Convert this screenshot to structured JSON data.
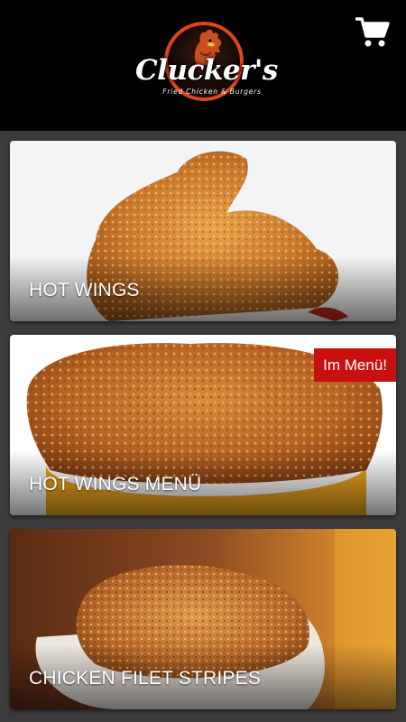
{
  "header": {
    "logo_name": "Clucker's",
    "logo_tagline": "Fried Chicken & Burgers",
    "cart_icon": "shopping-cart-icon"
  },
  "categories": [
    {
      "title": "HOT WINGS",
      "badge": ""
    },
    {
      "title": "HOT WINGS MENÜ",
      "badge": "Im Menü!"
    },
    {
      "title": "CHICKEN FILET STRIPES",
      "badge": ""
    }
  ],
  "colors": {
    "header_bg": "#000000",
    "page_bg": "#3b3b3b",
    "logo_accent": "#e0461a",
    "badge_bg": "#c81010"
  }
}
